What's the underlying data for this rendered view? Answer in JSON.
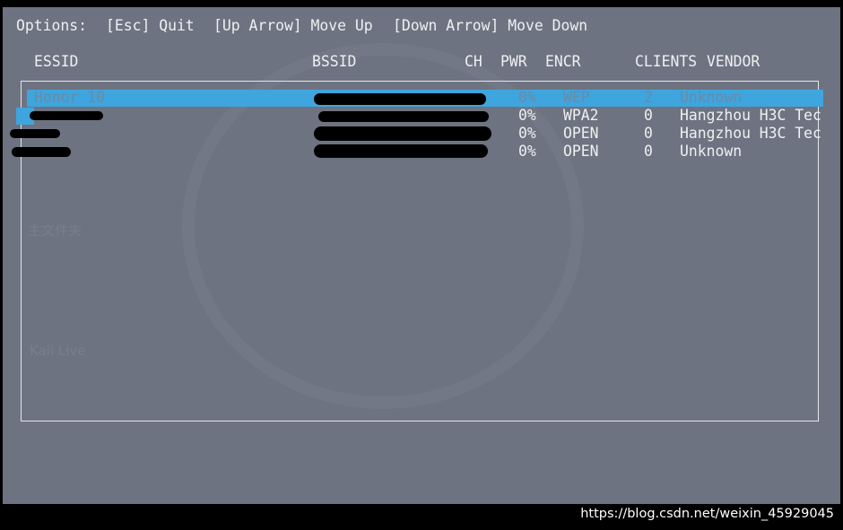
{
  "options_bar": {
    "label": "Options:",
    "items": [
      "[Esc] Quit",
      "[Up Arrow] Move Up",
      "[Down Arrow] Move Down"
    ]
  },
  "table": {
    "columns": {
      "essid": "ESSID",
      "bssid": "BSSID",
      "ch": "CH",
      "pwr": "PWR",
      "encr": "ENCR",
      "clients": "CLIENTS",
      "vendor": "VENDOR"
    },
    "rows": [
      {
        "essid": "Honor 10",
        "pwr": "0%",
        "encr": "WEP",
        "clients": "2",
        "vendor": "Unknown",
        "selected": true
      },
      {
        "essid": "",
        "pwr": "0%",
        "encr": "WPA2",
        "clients": "0",
        "vendor": "Hangzhou H3C Tec"
      },
      {
        "essid": "",
        "pwr": "0%",
        "encr": "OPEN",
        "clients": "0",
        "vendor": "Hangzhou H3C Tec"
      },
      {
        "essid": "",
        "pwr": "0%",
        "encr": "OPEN",
        "clients": "0",
        "vendor": "Unknown"
      }
    ]
  },
  "desktop_ghost": {
    "home_folder": "主文件夹",
    "kali_live": "Kali Live"
  },
  "watermark": "https://blog.csdn.net/weixin_45929045",
  "colors": {
    "background": "#6d7380",
    "highlight": "#3fa5de",
    "text": "#eef0f2"
  }
}
